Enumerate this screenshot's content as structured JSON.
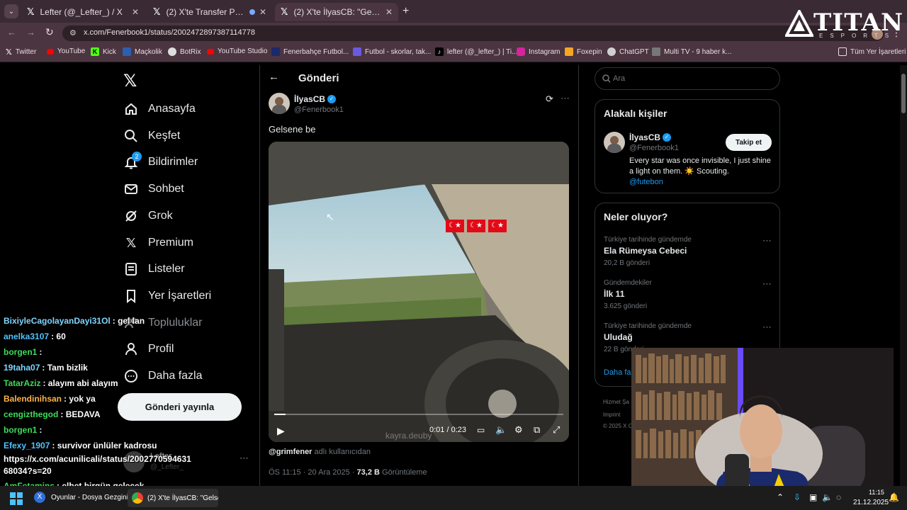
{
  "browser": {
    "tabs": [
      {
        "title": "Lefter (@_Lefter_) / X",
        "active": false
      },
      {
        "title": "(2) X'te Transfer Postası: \"",
        "active": false
      },
      {
        "title": "(2) X'te İlyasCB: \"Gelsene be htt",
        "active": true
      }
    ],
    "url": "x.com/Fenerbook1/status/2002472897387114778",
    "bookmarks": [
      "Twitter",
      "YouTube",
      "Kick",
      "Maçkolik",
      "BotRix",
      "YouTube Studio",
      "Fenerbahçe Futbol...",
      "Futbol - skorlar, tak...",
      "lefter (@_lefter_) | Ti...",
      "Instagram",
      "Foxepin",
      "ChatGPT",
      "Multi TV - 9 haber k..."
    ],
    "all_bookmarks": "Tüm Yer İşaretleri"
  },
  "watermark": {
    "brand": "TITAN",
    "sub": "ESPORTS"
  },
  "nav": {
    "items": [
      "Anasayfa",
      "Keşfet",
      "Bildirimler",
      "Sohbet",
      "Grok",
      "Premium",
      "Listeler",
      "Yer İşaretleri",
      "Topluluklar",
      "Profil",
      "Daha fazla"
    ],
    "notification_count": "2",
    "post_button": "Gönderi yayınla",
    "account_name": "Lefter",
    "account_handle": "@_Lefter_"
  },
  "post": {
    "header_title": "Gönderi",
    "author_name": "İlyasCB",
    "author_handle": "@Fenerbook1",
    "text": "Gelsene be",
    "video_time": "0:01 / 0:23",
    "video_progress": 0.04,
    "video_watermark": "kayra.deuby",
    "credit_user": "@grimfener",
    "credit_suffix": "adlı kullanıcıdan",
    "timestamp": "ÖS 11:15 · 20 Ara 2025 ·",
    "views": "73,2 B",
    "views_label": "Görüntüleme"
  },
  "sidebar": {
    "search_placeholder": "Ara",
    "related_title": "Alakalı kişiler",
    "related_name": "İlyasCB",
    "related_handle": "@Fenerbook1",
    "related_bio": "Every star was once invisible, I just shine a light on them. ☀️ Scouting.",
    "related_link": "@futebon",
    "follow_button": "Takip et",
    "trends_title": "Neler oluyor?",
    "trends": [
      {
        "meta": "Türkiye tarihinde gündemde",
        "name": "Ela Rümeysa Cebeci",
        "count": "20,2 B gönderi"
      },
      {
        "meta": "Gündemdekiler",
        "name": "İlk 11",
        "count": "3.625 gönderi"
      },
      {
        "meta": "Türkiye tarihinde gündemde",
        "name": "Uludağ",
        "count": "22 B gönderi"
      }
    ],
    "show_more": "Daha fa",
    "footer_1": "Hizmet Şa",
    "footer_2": "Imprint",
    "footer_3": "© 2025 X C"
  },
  "chat": [
    {
      "user": "BixiyleCagolayanDayi31Ol",
      "msg": "gel lan",
      "color": "#7fd6ff"
    },
    {
      "user": "anelka3107",
      "msg": "60",
      "color": "#4fc3ff"
    },
    {
      "user": "borgen1",
      "msg": "",
      "color": "#3ddc5a"
    },
    {
      "user": "19taha07",
      "msg": "Tam bizlik",
      "color": "#7fd6ff"
    },
    {
      "user": "TatarAziz",
      "msg": "alayım abi alayım",
      "color": "#3ddc5a"
    },
    {
      "user": "Balendinihsan",
      "msg": "yok ya",
      "color": "#ffb347"
    },
    {
      "user": "cengizthegod",
      "msg": "BEDAVA",
      "color": "#3ddc5a"
    },
    {
      "user": "borgen1",
      "msg": "",
      "color": "#3ddc5a"
    },
    {
      "user": "Efexy_1907",
      "msg": "survivor ünlüler kadrosu",
      "color": "#4fc3ff"
    },
    {
      "user": "",
      "msg": "https://x.com/acunilicali/status/2002770594631 68034?s=20",
      "color": "#ffffff"
    },
    {
      "user": "AmFetamins",
      "msg": "elbet birgün gelecek",
      "color": "#3ddc5a"
    }
  ],
  "taskbar": {
    "app1": "Oyunlar - Dosya Gezgini",
    "app2": "(2) X'te İlyasCB: \"Gelsen",
    "clock_date": "21.12.2025",
    "clock_time": "11:15"
  }
}
